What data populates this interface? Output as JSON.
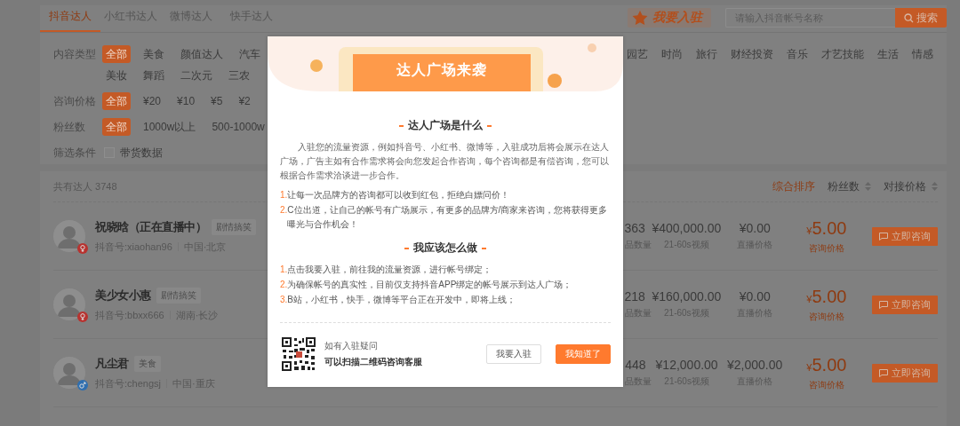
{
  "tabs": [
    {
      "label": "抖音达人",
      "selected": true
    },
    {
      "label": "小红书达人",
      "selected": false
    },
    {
      "label": "微博达人",
      "selected": false
    },
    {
      "label": "快手达人",
      "selected": false
    }
  ],
  "join_button": {
    "label": "我要入驻"
  },
  "search": {
    "placeholder": "请输入抖音帐号名称",
    "button": "搜索"
  },
  "filters": [
    {
      "kind": "chips",
      "label": "内容类型",
      "options": [
        {
          "text": "全部",
          "selected": true
        },
        {
          "text": "美食",
          "selected": false
        },
        {
          "text": "颜值达人",
          "selected": false
        },
        {
          "text": "汽车",
          "selected": false
        }
      ],
      "options_right": [
        {
          "text": "园艺",
          "selected": false
        },
        {
          "text": "时尚",
          "selected": false
        },
        {
          "text": "旅行",
          "selected": false
        },
        {
          "text": "财经投资",
          "selected": false
        },
        {
          "text": "音乐",
          "selected": false
        },
        {
          "text": "才艺技能",
          "selected": false
        },
        {
          "text": "生活",
          "selected": false
        },
        {
          "text": "情感",
          "selected": false
        }
      ],
      "options_line2": [
        {
          "text": "美妆",
          "selected": false
        },
        {
          "text": "舞蹈",
          "selected": false
        },
        {
          "text": "二次元",
          "selected": false
        },
        {
          "text": "三农",
          "selected": false
        }
      ]
    },
    {
      "kind": "chips",
      "label": "咨询价格",
      "options": [
        {
          "text": "全部",
          "selected": true
        },
        {
          "text": "¥20",
          "selected": false
        },
        {
          "text": "¥10",
          "selected": false
        },
        {
          "text": "¥5",
          "selected": false
        },
        {
          "text": "¥2",
          "selected": false
        }
      ]
    },
    {
      "kind": "chips",
      "label": "粉丝数",
      "options": [
        {
          "text": "全部",
          "selected": true
        },
        {
          "text": "1000w以上",
          "selected": false
        },
        {
          "text": "500-1000w",
          "selected": false
        }
      ]
    },
    {
      "kind": "checkbox",
      "label": "筛选条件",
      "options": [
        {
          "text": "带货数据",
          "checked": false
        }
      ]
    }
  ],
  "list": {
    "total": "共有达人 3748",
    "sorts": [
      {
        "label": "综合排序",
        "selected": true,
        "sortable": false
      },
      {
        "label": "粉丝数",
        "selected": false,
        "sortable": true
      },
      {
        "label": "对接价格",
        "selected": false,
        "sortable": true
      }
    ]
  },
  "rows": [
    {
      "name": "祝晓晗（正在直播中）",
      "tag": "剧情搞笑",
      "account": "抖音号:xiaohan96",
      "location": "中国·北京",
      "gender": {
        "kind": "female"
      },
      "works": "363",
      "works_label": "品数量",
      "video_price": "¥400,000.00",
      "video_label": "21-60s视频",
      "live_price": "¥0.00",
      "live_label": "直播价格",
      "currency": "¥",
      "consult_price": "5.00",
      "consult_label": "咨询价格",
      "button": "立即咨询"
    },
    {
      "name": "美少女小惠",
      "tag": "剧情搞笑",
      "account": "抖音号:bbxx666",
      "location": "湖南·长沙",
      "gender": {
        "kind": "female"
      },
      "works": "218",
      "works_label": "品数量",
      "video_price": "¥160,000.00",
      "video_label": "21-60s视频",
      "live_price": "¥0.00",
      "live_label": "直播价格",
      "currency": "¥",
      "consult_price": "5.00",
      "consult_label": "咨询价格",
      "button": "立即咨询"
    },
    {
      "name": "凡尘君",
      "tag": "美食",
      "account": "抖音号:chengsj",
      "location": "中国·重庆",
      "gender": {
        "kind": "male"
      },
      "works": "448",
      "works_label": "品数量",
      "video_price": "¥12,000.00",
      "video_label": "21-60s视频",
      "live_price": "¥2,000.00",
      "live_label": "直播价格",
      "currency": "¥",
      "consult_price": "5.00",
      "consult_label": "咨询价格",
      "button": "立即咨询"
    }
  ],
  "modal": {
    "banner_title": "达人广场来袭",
    "sections": [
      {
        "title": "达人广场是什么",
        "paragraph": "入驻您的流量资源，例如抖音号、小红书、微博等，入驻成功后将会展示在达人广场，广告主如有合作需求将会向您发起合作咨询，每个咨询都是有偿咨询，您可以根据合作需求洽谈进一步合作。",
        "items": [
          {
            "number": "1.",
            "text": "让每一次品牌方的咨询都可以收到红包，拒绝白嫖问价！"
          },
          {
            "number": "2.",
            "text": "C位出道，让自己的帐号有广场展示，有更多的品牌方/商家来咨询，您将获得更多曝光与合作机会！"
          }
        ]
      },
      {
        "title": "我应该怎么做",
        "items": [
          {
            "number": "1.",
            "text": "点击我要入驻，前往我的流量资源，进行帐号绑定；"
          },
          {
            "number": "2.",
            "text": "为确保帐号的真实性，目前仅支持抖音APP绑定的帐号展示到达人广场；"
          },
          {
            "number": "3.",
            "text": "B站，小红书，快手，微博等平台正在开发中，即将上线；"
          }
        ]
      }
    ],
    "footer": {
      "question": "如有入驻疑问",
      "hint": "可以扫描二维码咨询客服"
    },
    "buttons": [
      {
        "label": "我要入驻",
        "kind": "default"
      },
      {
        "label": "我知道了",
        "kind": "primary"
      }
    ]
  }
}
